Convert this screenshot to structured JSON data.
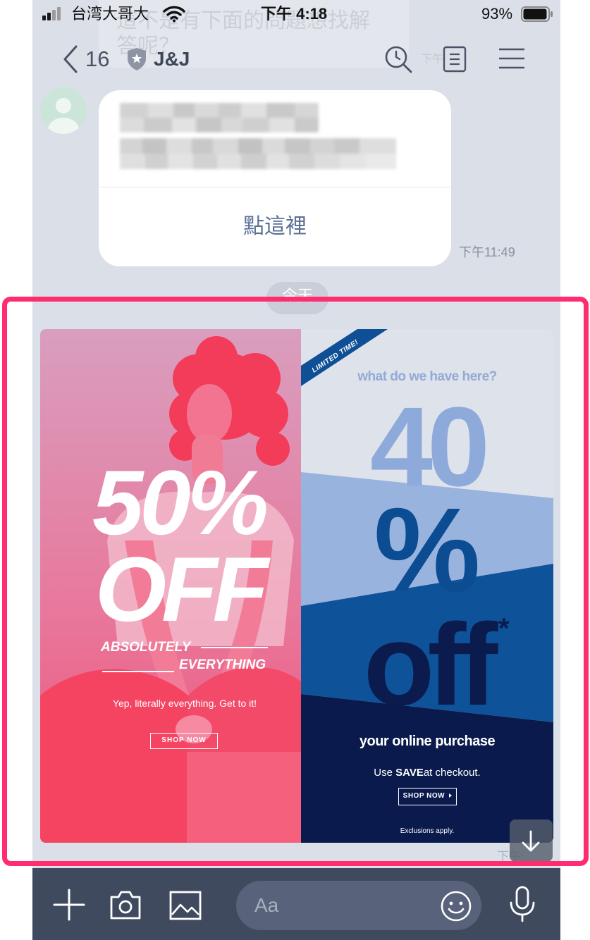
{
  "status_bar": {
    "carrier": "台湾大哥大",
    "time": "下午 4:18",
    "battery": "93%"
  },
  "header": {
    "back_count": "16",
    "title": "J&J"
  },
  "previous_message": {
    "line1": "這不是有下面的問題想找解",
    "line2": "答呢？",
    "time": "下午"
  },
  "message": {
    "link_label": "點這裡",
    "time": "下午11:49"
  },
  "date_separator": "今天",
  "promo": {
    "left": {
      "headline": "50%",
      "headline2": "OFF",
      "tag1": "ABSOLUTELY",
      "tag2": "EVERYTHING",
      "subtext": "Yep, literally everything. Get to it!",
      "button": "SHOP NOW"
    },
    "right": {
      "ribbon": "LIMITED TIME!",
      "intro": "what do we have here?",
      "number": "40",
      "percent": "%",
      "off": "off",
      "asterisk": "*",
      "line": "your online purchase",
      "code_prefix": "Use ",
      "code": "SAVE",
      "code_suffix": "at checkout.",
      "button": "SHOP NOW",
      "fine_print": "Exclusions apply."
    },
    "time": "下午"
  },
  "composer": {
    "placeholder": "Aa"
  },
  "icons": {
    "header": [
      "back-icon",
      "shield-icon",
      "search-icon",
      "notes-icon",
      "menu-icon"
    ],
    "composer": [
      "plus-icon",
      "camera-icon",
      "image-icon",
      "emoji-icon",
      "mic-icon"
    ],
    "overlay": "arrow-down-icon"
  },
  "colors": {
    "highlight_frame": "#ff2d6f",
    "chat_background": "#dbdfe8",
    "composer_bar": "#404a5f",
    "link": "#5a6e96"
  }
}
